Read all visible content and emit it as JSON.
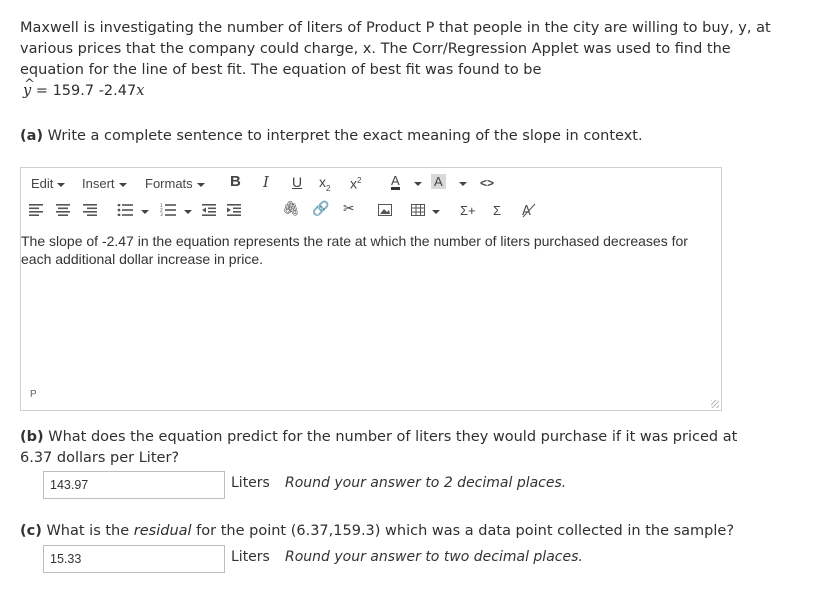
{
  "intro": {
    "text": "Maxwell is investigating the number of liters of Product P that people in the city are willing to buy, y, at various prices that the company could charge, x. The Corr/Regression Applet was used to find the equation for the line of best fit. The equation of best fit was found to be",
    "eq_lhs": "y",
    "eq_mid": " = 159.7 -2.47",
    "eq_var": "x"
  },
  "question_a": {
    "label": "(a)",
    "text": "Write a complete sentence to interpret the exact meaning of the slope in context."
  },
  "toolbar": {
    "edit": "Edit",
    "insert": "Insert",
    "formats": "Formats",
    "bold": "B",
    "italic": "I",
    "underline": "U",
    "subscript": "x",
    "superscript": "x",
    "font_color": "A",
    "bg_color": "A",
    "code": "<>",
    "sigma_plus": "Σ+",
    "sigma": "Σ"
  },
  "editor": {
    "content": "The slope of -2.47 in the equation represents the rate at which the number of liters purchased decreases for each additional dollar increase in price.",
    "status": "P"
  },
  "question_b": {
    "label": "(b)",
    "text": "What does the equation predict for the number of liters they would purchase if it was priced at 6.37 dollars per Liter?",
    "answer": "143.97",
    "unit": "Liters",
    "hint": "Round your answer to 2 decimal places."
  },
  "question_c": {
    "label": "(c)",
    "text_before": "What is the ",
    "text_em": "residual",
    "text_after": " for the point (6.37,159.3) which was a data point collected in the sample?",
    "answer": "15.33",
    "unit": "Liters",
    "hint": "Round your answer to two decimal places."
  },
  "colors": {
    "font_color_bar": "#333333",
    "bg_color_box": "#d9d9d9"
  }
}
